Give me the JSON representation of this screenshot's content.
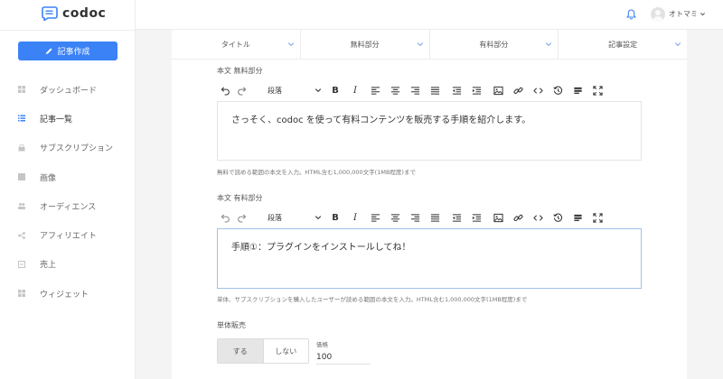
{
  "app": {
    "logo_text": "codoc"
  },
  "sidebar": {
    "create_button": "記事作成",
    "items": [
      {
        "label": "ダッシュボード",
        "icon": "dashboard-icon"
      },
      {
        "label": "記事一覧",
        "icon": "list-icon",
        "active": true
      },
      {
        "label": "サブスクリプション",
        "icon": "subscription-icon"
      },
      {
        "label": "画像",
        "icon": "image-icon"
      },
      {
        "label": "オーディエンス",
        "icon": "audience-icon"
      },
      {
        "label": "アフィリエイト",
        "icon": "share-icon"
      },
      {
        "label": "売上",
        "icon": "sales-icon"
      },
      {
        "label": "ウィジェット",
        "icon": "widget-icon"
      }
    ]
  },
  "header": {
    "username": "オトマミ"
  },
  "tabs": [
    "タイトル",
    "無料部分",
    "有料部分",
    "記事設定"
  ],
  "free_section": {
    "label": "本文 無料部分",
    "paragraph_style": "段落",
    "content": "さっそく、codoc を使って有料コンテンツを販売する手順を紹介します。",
    "help": "無料で読める範囲の本文を入力。HTML含む1,000,000文字(1MB程度)まで"
  },
  "paid_section": {
    "label": "本文 有料部分",
    "paragraph_style": "段落",
    "content": "手順①：プラグインをインストールしてね！",
    "help": "単体、サブスクリプションを購入したユーザーが読める範囲の本文を入力。HTML含む1,000,000文字(1MB程度)まで"
  },
  "single_sale": {
    "label": "単体販売",
    "options": [
      "する",
      "しない"
    ],
    "selected": "する",
    "price_label": "価格",
    "price_value": "100"
  },
  "colors": {
    "accent": "#3b82f6",
    "active_icon": "#3b82f6"
  }
}
